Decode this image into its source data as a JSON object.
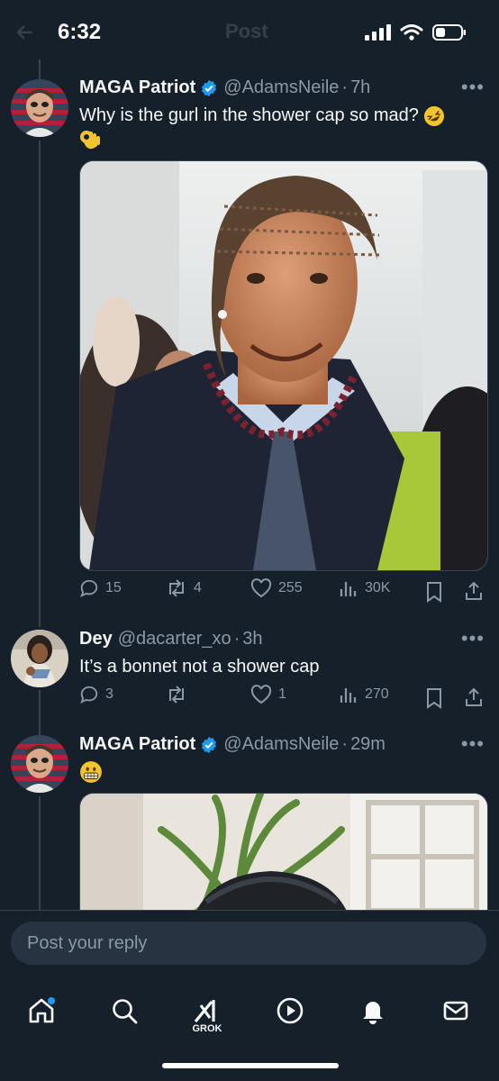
{
  "status_bar": {
    "time": "6:32"
  },
  "ghost_header": {
    "title": "Post"
  },
  "tweets": [
    {
      "name": "MAGA Patriot",
      "handle": "@AdamsNeile",
      "age": "7h",
      "text": "Why is the gurl in the shower cap so mad?",
      "emojis": [
        "rolling-on-floor-laughing",
        "ok-hand"
      ],
      "media": "photo-man-cornrows-dark-coat-beaded-necklace",
      "stats": {
        "replies": "15",
        "reposts": "4",
        "likes": "255",
        "views": "30K"
      }
    },
    {
      "name": "Dey",
      "handle": "@dacarter_xo",
      "age": "3h",
      "text": "It’s a bonnet not a shower cap",
      "stats": {
        "replies": "3",
        "reposts": "",
        "likes": "1",
        "views": "270"
      }
    },
    {
      "name": "MAGA Patriot",
      "handle": "@AdamsNeile",
      "age": "29m",
      "emojis": [
        "grimacing-face"
      ],
      "media": "photo-sculpture-with-plant"
    }
  ],
  "reply": {
    "placeholder": "Post your reply"
  },
  "tabbar": {
    "grok_label": "GROK"
  },
  "colors": {
    "background": "#15202b",
    "accent": "#1d9bf0",
    "muted": "#8b98a5"
  }
}
